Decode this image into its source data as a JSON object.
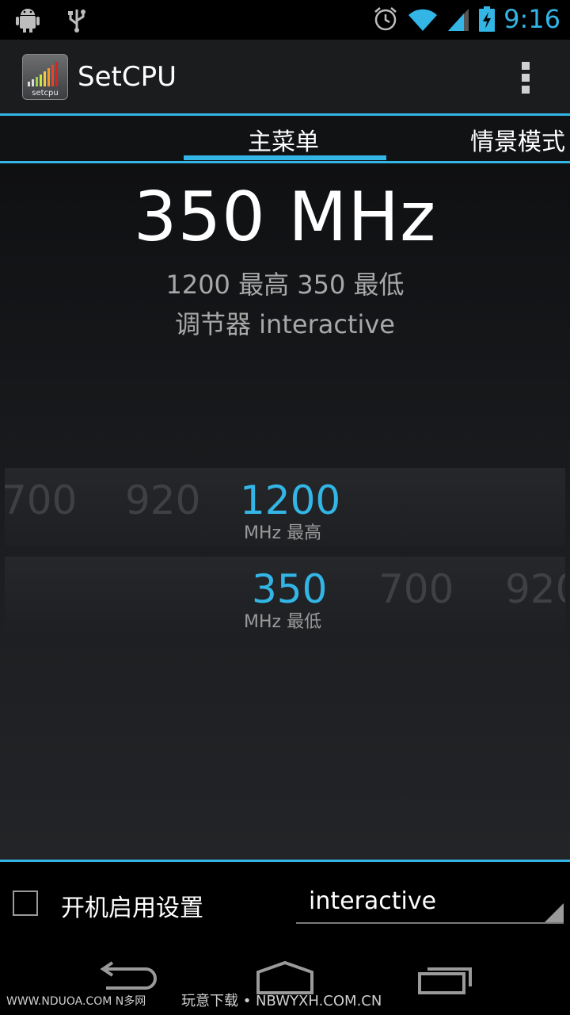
{
  "status_bar": {
    "time": "9:16",
    "icons_left": [
      "android-debug-icon",
      "usb-icon"
    ],
    "icons_right": [
      "alarm-icon",
      "wifi-icon",
      "signal-icon",
      "battery-charging-icon"
    ],
    "accent": "#33b5e5"
  },
  "action_bar": {
    "icon_label": "setcpu",
    "title": "SetCPU"
  },
  "tabs": [
    {
      "label": "主菜单",
      "selected": true
    },
    {
      "label": "情景模式",
      "selected": false
    }
  ],
  "main": {
    "current_frequency": "350 MHz",
    "max_min_line": "1200 最高 350 最低",
    "governor_line": "调节器 interactive"
  },
  "max_picker": {
    "values": [
      "700",
      "920",
      "1200"
    ],
    "selected": "1200",
    "sub_label": "MHz 最高"
  },
  "min_picker": {
    "values": [
      "350",
      "700",
      "920"
    ],
    "selected": "350",
    "sub_label": "MHz 最低"
  },
  "bottom": {
    "boot_label": "开机启用设置",
    "boot_checked": false,
    "governor_value": "interactive"
  },
  "watermark": {
    "left": "WWW.NDUOA.COM N多网",
    "middle": "玩意下载 • NBWYXH.COM.CN"
  }
}
